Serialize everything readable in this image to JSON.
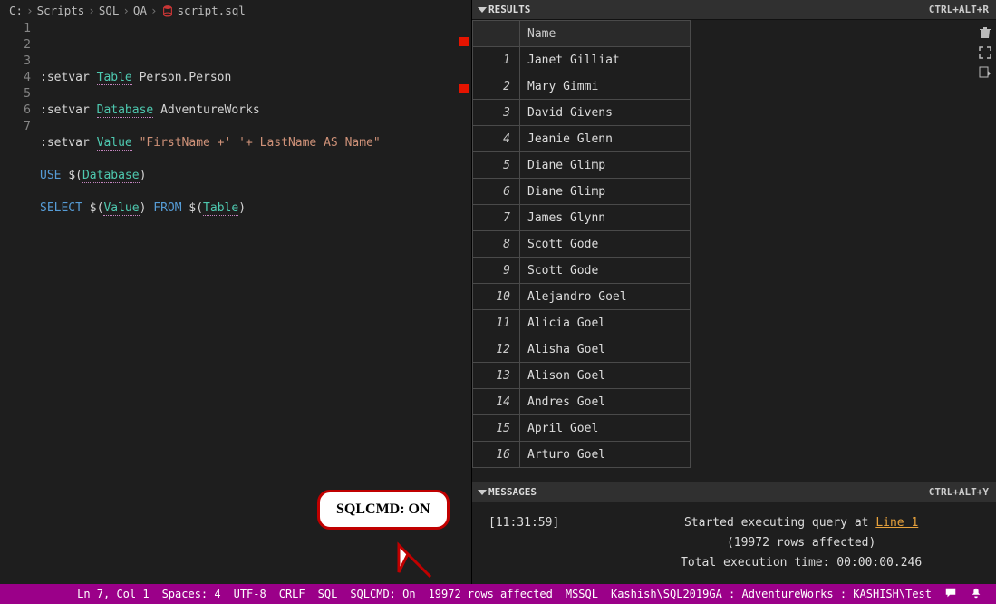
{
  "breadcrumb": {
    "drive": "C:",
    "parts": [
      "Scripts",
      "SQL",
      "QA"
    ],
    "file": "script.sql"
  },
  "editor": {
    "lines": [
      1,
      2,
      3,
      4,
      5,
      6,
      7
    ]
  },
  "code": {
    "l2_setvar": ":setvar",
    "l2_var": "Table",
    "l2_val": "Person.Person",
    "l3_setvar": ":setvar",
    "l3_var": "Database",
    "l3_val": "AdventureWorks",
    "l4_setvar": ":setvar",
    "l4_var": "Value",
    "l4_val": "\"FirstName +' '+ LastName AS Name\"",
    "l5_use": "USE",
    "l5_dollar": "$(",
    "l5_db": "Database",
    "l5_close": ")",
    "l6_select": "SELECT",
    "l6_d1": "$(",
    "l6_val": "Value",
    "l6_c1": ")",
    "l6_from": "FROM",
    "l6_d2": "$(",
    "l6_tbl": "Table",
    "l6_c2": ")"
  },
  "callout": {
    "text": "SQLCMD: ON"
  },
  "results": {
    "panel_title": "RESULTS",
    "shortcut": "CTRL+ALT+R",
    "column_name": "Name",
    "rows": [
      {
        "n": 1,
        "name": "Janet Gilliat"
      },
      {
        "n": 2,
        "name": "Mary Gimmi"
      },
      {
        "n": 3,
        "name": "David Givens"
      },
      {
        "n": 4,
        "name": "Jeanie Glenn"
      },
      {
        "n": 5,
        "name": "Diane Glimp"
      },
      {
        "n": 6,
        "name": "Diane Glimp"
      },
      {
        "n": 7,
        "name": "James Glynn"
      },
      {
        "n": 8,
        "name": "Scott Gode"
      },
      {
        "n": 9,
        "name": "Scott Gode"
      },
      {
        "n": 10,
        "name": "Alejandro Goel"
      },
      {
        "n": 11,
        "name": "Alicia Goel"
      },
      {
        "n": 12,
        "name": "Alisha Goel"
      },
      {
        "n": 13,
        "name": "Alison Goel"
      },
      {
        "n": 14,
        "name": "Andres Goel"
      },
      {
        "n": 15,
        "name": "April Goel"
      },
      {
        "n": 16,
        "name": "Arturo Goel"
      }
    ]
  },
  "messages": {
    "panel_title": "MESSAGES",
    "shortcut": "CTRL+ALT+Y",
    "time": "[11:31:59]",
    "started": "Started executing query at ",
    "line_link": "Line 1",
    "rows_affected": "(19972 rows affected)",
    "exec_time": "Total execution time: 00:00:00.246"
  },
  "status": {
    "ln": "Ln 7, Col 1",
    "spaces": "Spaces: 4",
    "enc": "UTF-8",
    "eol": "CRLF",
    "lang": "SQL",
    "sqlcmd": "SQLCMD: On",
    "rows": "19972 rows affected",
    "mssql": "MSSQL",
    "conn": "Kashish\\SQL2019GA : AdventureWorks : KASHISH\\Test"
  }
}
